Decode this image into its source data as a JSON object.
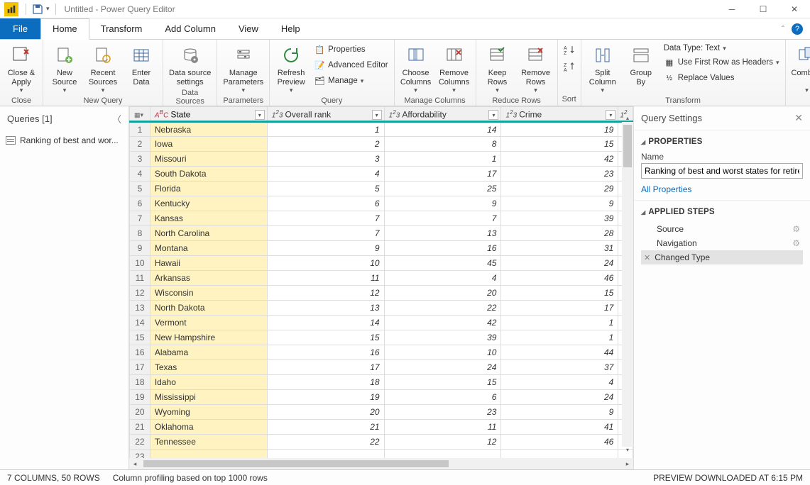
{
  "title": "Untitled - Power Query Editor",
  "menus": {
    "file": "File",
    "home": "Home",
    "transform": "Transform",
    "add": "Add Column",
    "view": "View",
    "help": "Help"
  },
  "ribbon": {
    "close": {
      "close_apply": "Close &\nApply",
      "group": "Close"
    },
    "new_query": {
      "new_source": "New\nSource",
      "recent": "Recent\nSources",
      "enter": "Enter\nData",
      "group": "New Query"
    },
    "data_sources": {
      "settings": "Data source\nsettings",
      "group": "Data Sources"
    },
    "parameters": {
      "manage": "Manage\nParameters",
      "group": "Parameters"
    },
    "query": {
      "refresh": "Refresh\nPreview",
      "props": "Properties",
      "adv": "Advanced Editor",
      "mng": "Manage",
      "group": "Query"
    },
    "manage_cols": {
      "choose": "Choose\nColumns",
      "remove": "Remove\nColumns",
      "group": "Manage Columns"
    },
    "reduce": {
      "keep": "Keep\nRows",
      "remove": "Remove\nRows",
      "group": "Reduce Rows"
    },
    "sort": {
      "group": "Sort"
    },
    "transform": {
      "split": "Split\nColumn",
      "group_by": "Group\nBy",
      "dtype": "Data Type: Text",
      "first_row": "Use First Row as Headers",
      "replace": "Replace Values",
      "group": "Transform"
    },
    "combine": {
      "combine": "Combine"
    }
  },
  "queries": {
    "header": "Queries [1]",
    "item": "Ranking of best and wor..."
  },
  "columns": {
    "c0": "State",
    "c1": "Overall rank",
    "c2": "Affordability",
    "c3": "Crime"
  },
  "rows": [
    {
      "n": "1",
      "s": "Nebraska",
      "r": "1",
      "a": "14",
      "c": "19"
    },
    {
      "n": "2",
      "s": "Iowa",
      "r": "2",
      "a": "8",
      "c": "15"
    },
    {
      "n": "3",
      "s": "Missouri",
      "r": "3",
      "a": "1",
      "c": "42"
    },
    {
      "n": "4",
      "s": "South Dakota",
      "r": "4",
      "a": "17",
      "c": "23"
    },
    {
      "n": "5",
      "s": "Florida",
      "r": "5",
      "a": "25",
      "c": "29"
    },
    {
      "n": "6",
      "s": "Kentucky",
      "r": "6",
      "a": "9",
      "c": "9"
    },
    {
      "n": "7",
      "s": "Kansas",
      "r": "7",
      "a": "7",
      "c": "39"
    },
    {
      "n": "8",
      "s": "North Carolina",
      "r": "7",
      "a": "13",
      "c": "28"
    },
    {
      "n": "9",
      "s": "Montana",
      "r": "9",
      "a": "16",
      "c": "31"
    },
    {
      "n": "10",
      "s": "Hawaii",
      "r": "10",
      "a": "45",
      "c": "24"
    },
    {
      "n": "11",
      "s": "Arkansas",
      "r": "11",
      "a": "4",
      "c": "46"
    },
    {
      "n": "12",
      "s": "Wisconsin",
      "r": "12",
      "a": "20",
      "c": "15"
    },
    {
      "n": "13",
      "s": "North Dakota",
      "r": "13",
      "a": "22",
      "c": "17"
    },
    {
      "n": "14",
      "s": "Vermont",
      "r": "14",
      "a": "42",
      "c": "1"
    },
    {
      "n": "15",
      "s": "New Hampshire",
      "r": "15",
      "a": "39",
      "c": "1"
    },
    {
      "n": "16",
      "s": "Alabama",
      "r": "16",
      "a": "10",
      "c": "44"
    },
    {
      "n": "17",
      "s": "Texas",
      "r": "17",
      "a": "24",
      "c": "37"
    },
    {
      "n": "18",
      "s": "Idaho",
      "r": "18",
      "a": "15",
      "c": "4"
    },
    {
      "n": "19",
      "s": "Mississippi",
      "r": "19",
      "a": "6",
      "c": "24"
    },
    {
      "n": "20",
      "s": "Wyoming",
      "r": "20",
      "a": "23",
      "c": "9"
    },
    {
      "n": "21",
      "s": "Oklahoma",
      "r": "21",
      "a": "11",
      "c": "41"
    },
    {
      "n": "22",
      "s": "Tennessee",
      "r": "22",
      "a": "12",
      "c": "46"
    }
  ],
  "settings": {
    "header": "Query Settings",
    "props": "PROPERTIES",
    "name_lbl": "Name",
    "name_val": "Ranking of best and worst states for retire",
    "all_props": "All Properties",
    "steps_hdr": "APPLIED STEPS",
    "steps": {
      "source": "Source",
      "nav": "Navigation",
      "changed": "Changed Type"
    }
  },
  "status": {
    "left1": "7 COLUMNS, 50 ROWS",
    "left2": "Column profiling based on top 1000 rows",
    "right": "PREVIEW DOWNLOADED AT 6:15 PM"
  }
}
